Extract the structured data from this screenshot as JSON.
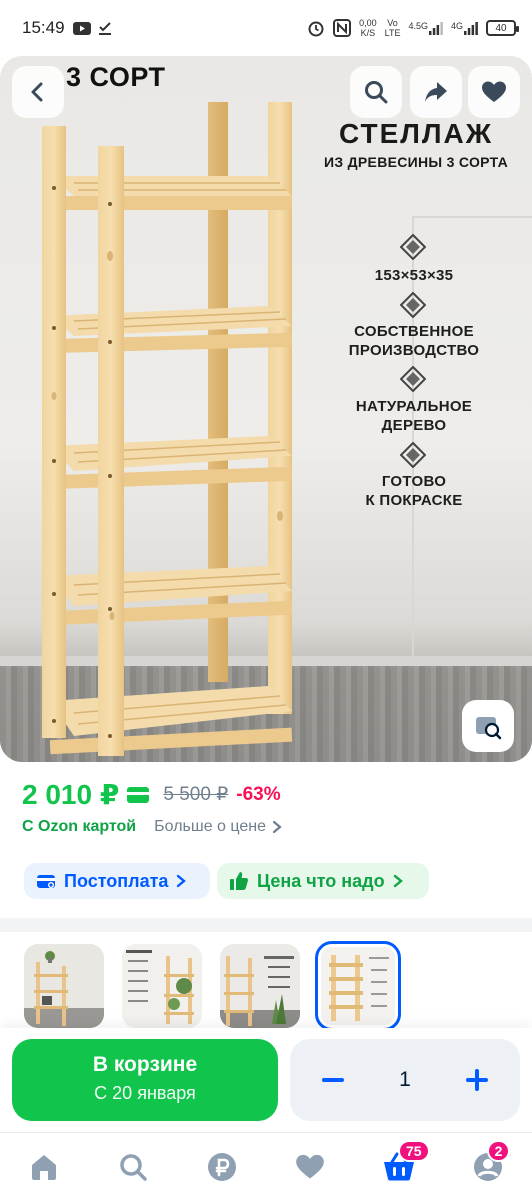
{
  "status_bar": {
    "time": "15:49",
    "net_speed_top": "0,00",
    "net_speed_bottom": "K/S",
    "volte_top": "Vo",
    "volte_bottom": "LTE",
    "sig1": "4.5G",
    "sig2": "4G",
    "battery": "40"
  },
  "hero": {
    "sort_badge": "3 СОРТ",
    "title": "СТЕЛЛАЖ",
    "subtitle": "ИЗ ДРЕВЕСИНЫ 3 СОРТА",
    "features": [
      "153×53×35",
      "СОБСТВЕННОЕ ПРОИЗВОДСТВО",
      "НАТУРАЛЬНОЕ ДЕРЕВО",
      "ГОТОВО К ПОКРАСКЕ"
    ],
    "features_lines": [
      [
        "153×53×35"
      ],
      [
        "СОБСТВЕННОЕ",
        "ПРОИЗВОДСТВО"
      ],
      [
        "НАТУРАЛЬНОЕ",
        "ДЕРЕВО"
      ],
      [
        "ГОТОВО",
        "К ПОКРАСКЕ"
      ]
    ]
  },
  "price": {
    "current": "2 010 ₽",
    "old": "5 500 ₽",
    "discount": "-63%",
    "ozon_card": "С Ozon картой",
    "more": "Больше о цене"
  },
  "chips": {
    "postpay": "Постоплата",
    "good_price": "Цена что надо"
  },
  "thumbnails": {
    "count": 4,
    "active_index": 3
  },
  "cart": {
    "button_label": "В корзине",
    "delivery": "С 20 января",
    "quantity": "1"
  },
  "nav": {
    "cart_badge": "75",
    "profile_badge": "2"
  },
  "colors": {
    "green": "#10c44c",
    "blue": "#005bff",
    "pink": "#f91155",
    "badge": "#f1117e"
  }
}
